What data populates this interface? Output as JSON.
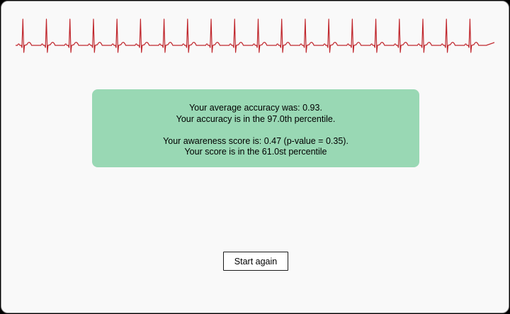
{
  "ecg": {
    "icon": "ecg-waveform",
    "beats": 20,
    "stroke_color": "#c0272d"
  },
  "results": {
    "accuracy_line": "Your average accuracy was: 0.93.",
    "accuracy_percentile_line": "Your accuracy is in the 97.0th percentile.",
    "awareness_line": "Your awareness score is: 0.47 (p-value = 0.35).",
    "awareness_percentile_line": "Your score is in the 61.0st percentile",
    "background_color": "#99d8b4"
  },
  "actions": {
    "start_again_label": "Start again"
  }
}
